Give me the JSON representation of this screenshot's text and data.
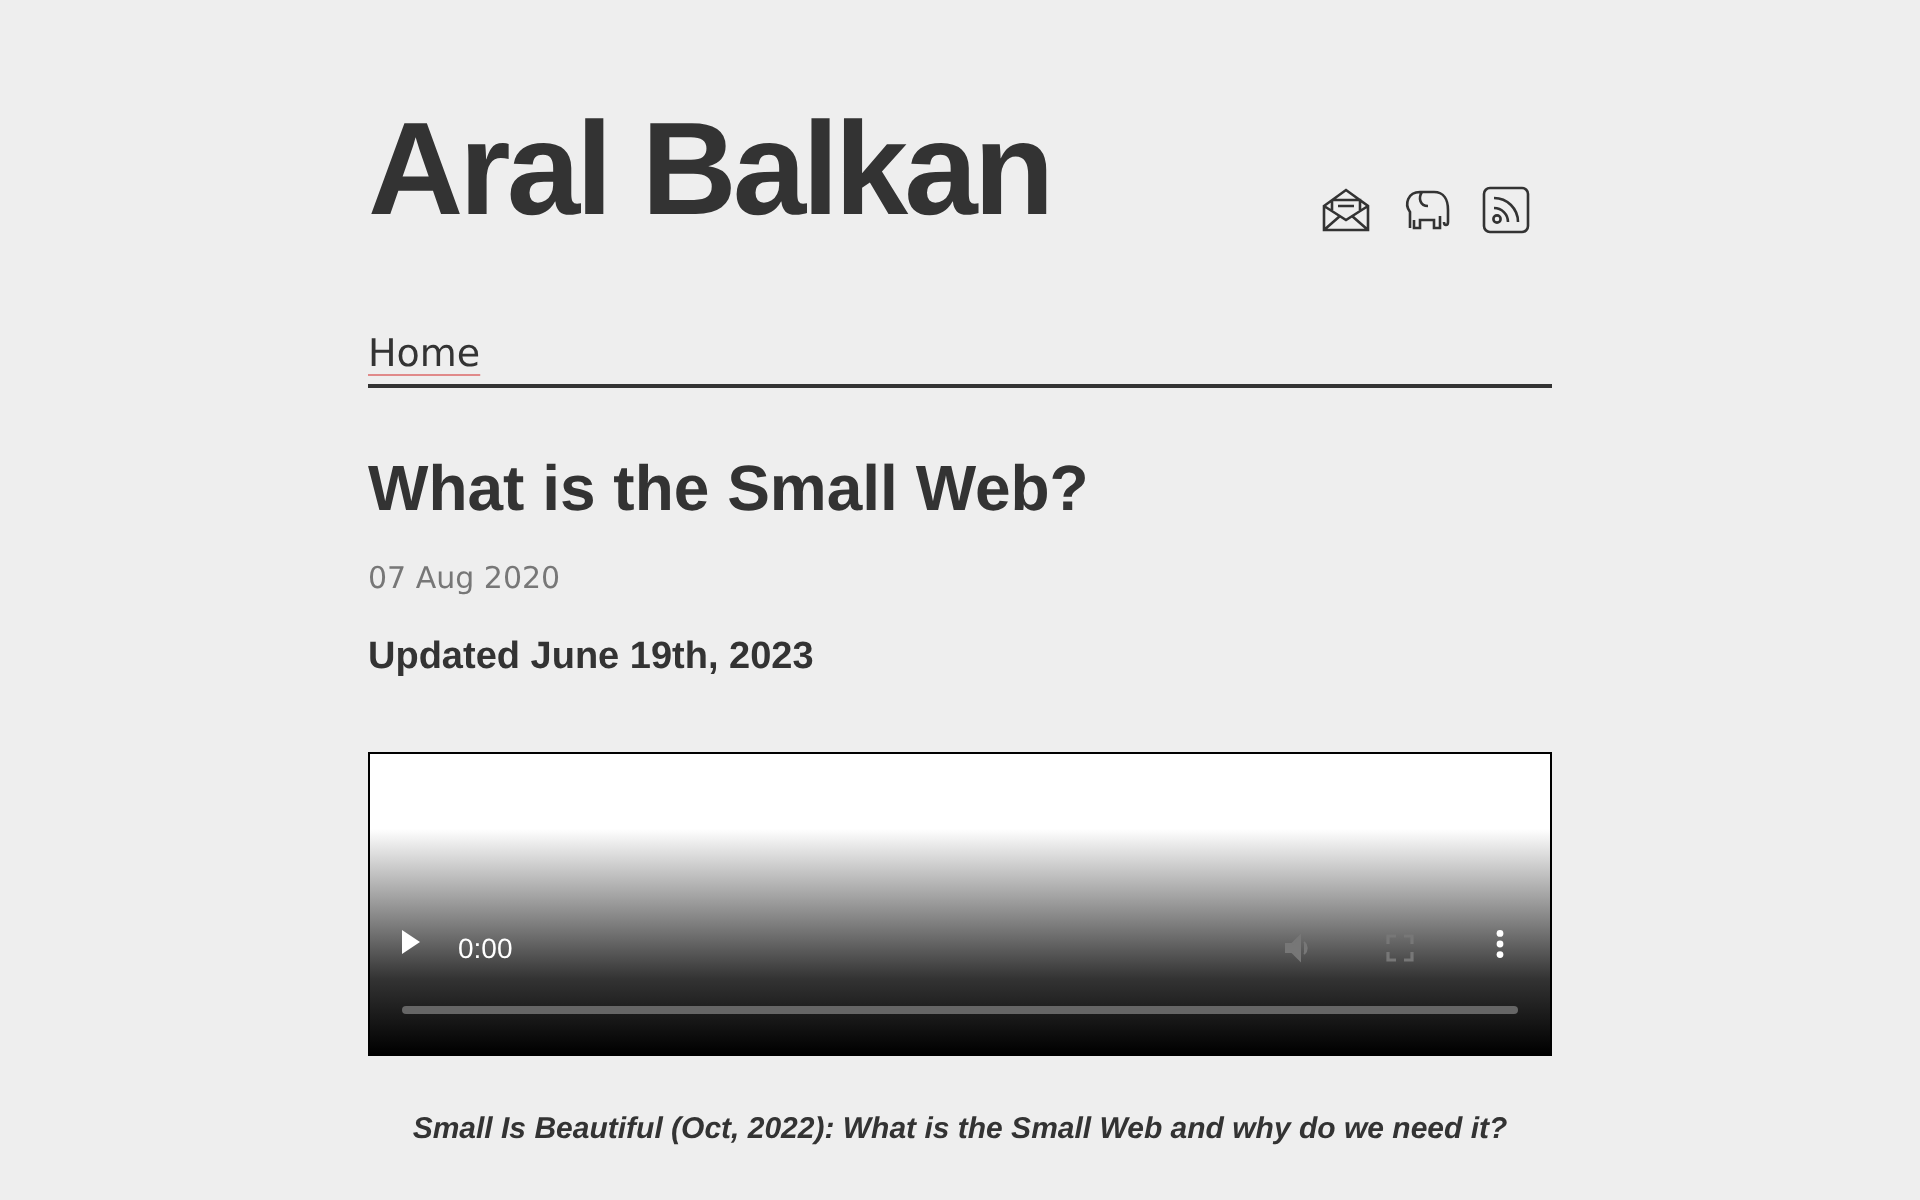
{
  "site": {
    "title": "Aral Balkan"
  },
  "header_icons": [
    {
      "kind": "mail"
    },
    {
      "kind": "elephant"
    },
    {
      "kind": "rss"
    }
  ],
  "nav": {
    "items": [
      {
        "label": "Home"
      }
    ]
  },
  "post": {
    "title": "What is the Small Web?",
    "date": "07 Aug 2020",
    "updated": "Updated June 19th, 2023",
    "video": {
      "time": "0:00",
      "mute_disabled": true,
      "fullscreen_disabled": true
    },
    "caption": "Small Is Beautiful (Oct, 2022): What is the Small Web and why do we need it?"
  }
}
